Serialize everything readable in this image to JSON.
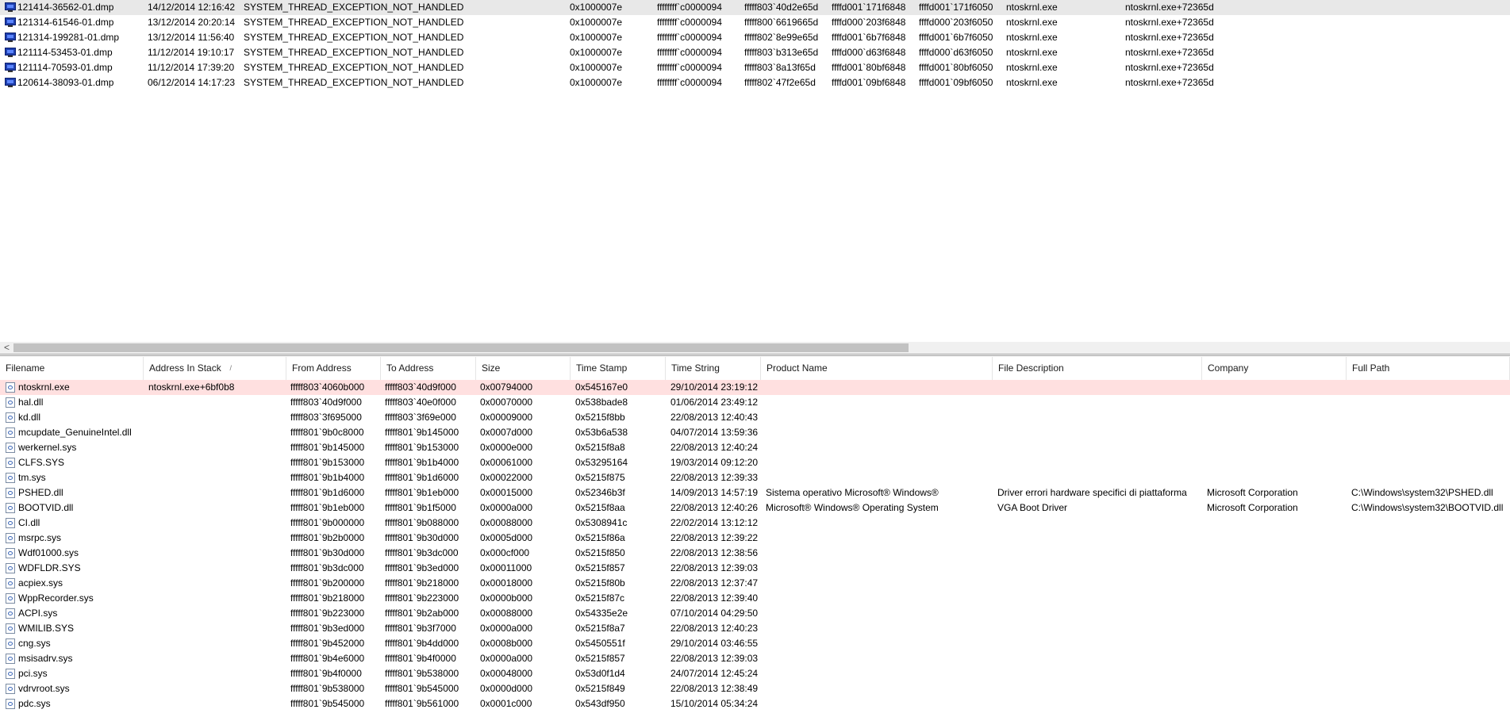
{
  "dump_list": {
    "rows": [
      {
        "file": "121414-36562-01.dmp",
        "date": "14/12/2014 12:16:42",
        "bug": "SYSTEM_THREAD_EXCEPTION_NOT_HANDLED",
        "code": "0x1000007e",
        "p1": "ffffffff`c0000094",
        "p2": "fffff803`40d2e65d",
        "p3": "ffffd001`171f6848",
        "p4": "ffffd001`171f6050",
        "driver": "ntoskrnl.exe",
        "addr": "ntoskrnl.exe+72365d"
      },
      {
        "file": "121314-61546-01.dmp",
        "date": "13/12/2014 20:20:14",
        "bug": "SYSTEM_THREAD_EXCEPTION_NOT_HANDLED",
        "code": "0x1000007e",
        "p1": "ffffffff`c0000094",
        "p2": "fffff800`6619665d",
        "p3": "ffffd000`203f6848",
        "p4": "ffffd000`203f6050",
        "driver": "ntoskrnl.exe",
        "addr": "ntoskrnl.exe+72365d"
      },
      {
        "file": "121314-199281-01.dmp",
        "date": "13/12/2014 11:56:40",
        "bug": "SYSTEM_THREAD_EXCEPTION_NOT_HANDLED",
        "code": "0x1000007e",
        "p1": "ffffffff`c0000094",
        "p2": "fffff802`8e99e65d",
        "p3": "ffffd001`6b7f6848",
        "p4": "ffffd001`6b7f6050",
        "driver": "ntoskrnl.exe",
        "addr": "ntoskrnl.exe+72365d"
      },
      {
        "file": "121114-53453-01.dmp",
        "date": "11/12/2014 19:10:17",
        "bug": "SYSTEM_THREAD_EXCEPTION_NOT_HANDLED",
        "code": "0x1000007e",
        "p1": "ffffffff`c0000094",
        "p2": "fffff803`b313e65d",
        "p3": "ffffd000`d63f6848",
        "p4": "ffffd000`d63f6050",
        "driver": "ntoskrnl.exe",
        "addr": "ntoskrnl.exe+72365d"
      },
      {
        "file": "121114-70593-01.dmp",
        "date": "11/12/2014 17:39:20",
        "bug": "SYSTEM_THREAD_EXCEPTION_NOT_HANDLED",
        "code": "0x1000007e",
        "p1": "ffffffff`c0000094",
        "p2": "fffff803`8a13f65d",
        "p3": "ffffd001`80bf6848",
        "p4": "ffffd001`80bf6050",
        "driver": "ntoskrnl.exe",
        "addr": "ntoskrnl.exe+72365d"
      },
      {
        "file": "120614-38093-01.dmp",
        "date": "06/12/2014 14:17:23",
        "bug": "SYSTEM_THREAD_EXCEPTION_NOT_HANDLED",
        "code": "0x1000007e",
        "p1": "ffffffff`c0000094",
        "p2": "fffff802`47f2e65d",
        "p3": "ffffd001`09bf6848",
        "p4": "ffffd001`09bf6050",
        "driver": "ntoskrnl.exe",
        "addr": "ntoskrnl.exe+72365d"
      }
    ]
  },
  "scrollbar": {
    "left_arrow": "<"
  },
  "module_list": {
    "columns": [
      "Filename",
      "Address In Stack",
      "From Address",
      "To Address",
      "Size",
      "Time Stamp",
      "Time String",
      "Product Name",
      "File Description",
      "Company",
      "Full Path"
    ],
    "sort_indicator": "/",
    "rows": [
      {
        "name": "ntoskrnl.exe",
        "stack": "ntoskrnl.exe+6bf0b8",
        "from": "fffff803`4060b000",
        "to": "fffff803`40d9f000",
        "size": "0x00794000",
        "ts": "0x545167e0",
        "tstr": "29/10/2014 23:19:12",
        "product": "",
        "desc": "",
        "company": "",
        "path": ""
      },
      {
        "name": "hal.dll",
        "stack": "",
        "from": "fffff803`40d9f000",
        "to": "fffff803`40e0f000",
        "size": "0x00070000",
        "ts": "0x538bade8",
        "tstr": "01/06/2014 23:49:12",
        "product": "",
        "desc": "",
        "company": "",
        "path": ""
      },
      {
        "name": "kd.dll",
        "stack": "",
        "from": "fffff803`3f695000",
        "to": "fffff803`3f69e000",
        "size": "0x00009000",
        "ts": "0x5215f8bb",
        "tstr": "22/08/2013 12:40:43",
        "product": "",
        "desc": "",
        "company": "",
        "path": ""
      },
      {
        "name": "mcupdate_GenuineIntel.dll",
        "stack": "",
        "from": "fffff801`9b0c8000",
        "to": "fffff801`9b145000",
        "size": "0x0007d000",
        "ts": "0x53b6a538",
        "tstr": "04/07/2014 13:59:36",
        "product": "",
        "desc": "",
        "company": "",
        "path": ""
      },
      {
        "name": "werkernel.sys",
        "stack": "",
        "from": "fffff801`9b145000",
        "to": "fffff801`9b153000",
        "size": "0x0000e000",
        "ts": "0x5215f8a8",
        "tstr": "22/08/2013 12:40:24",
        "product": "",
        "desc": "",
        "company": "",
        "path": ""
      },
      {
        "name": "CLFS.SYS",
        "stack": "",
        "from": "fffff801`9b153000",
        "to": "fffff801`9b1b4000",
        "size": "0x00061000",
        "ts": "0x53295164",
        "tstr": "19/03/2014 09:12:20",
        "product": "",
        "desc": "",
        "company": "",
        "path": ""
      },
      {
        "name": "tm.sys",
        "stack": "",
        "from": "fffff801`9b1b4000",
        "to": "fffff801`9b1d6000",
        "size": "0x00022000",
        "ts": "0x5215f875",
        "tstr": "22/08/2013 12:39:33",
        "product": "",
        "desc": "",
        "company": "",
        "path": ""
      },
      {
        "name": "PSHED.dll",
        "stack": "",
        "from": "fffff801`9b1d6000",
        "to": "fffff801`9b1eb000",
        "size": "0x00015000",
        "ts": "0x52346b3f",
        "tstr": "14/09/2013 14:57:19",
        "product": "Sistema operativo Microsoft® Windows®",
        "desc": "Driver errori hardware specifici di piattaforma",
        "company": "Microsoft Corporation",
        "path": "C:\\Windows\\system32\\PSHED.dll"
      },
      {
        "name": "BOOTVID.dll",
        "stack": "",
        "from": "fffff801`9b1eb000",
        "to": "fffff801`9b1f5000",
        "size": "0x0000a000",
        "ts": "0x5215f8aa",
        "tstr": "22/08/2013 12:40:26",
        "product": "Microsoft® Windows® Operating System",
        "desc": "VGA Boot Driver",
        "company": "Microsoft Corporation",
        "path": "C:\\Windows\\system32\\BOOTVID.dll"
      },
      {
        "name": "CI.dll",
        "stack": "",
        "from": "fffff801`9b000000",
        "to": "fffff801`9b088000",
        "size": "0x00088000",
        "ts": "0x5308941c",
        "tstr": "22/02/2014 13:12:12",
        "product": "",
        "desc": "",
        "company": "",
        "path": ""
      },
      {
        "name": "msrpc.sys",
        "stack": "",
        "from": "fffff801`9b2b0000",
        "to": "fffff801`9b30d000",
        "size": "0x0005d000",
        "ts": "0x5215f86a",
        "tstr": "22/08/2013 12:39:22",
        "product": "",
        "desc": "",
        "company": "",
        "path": ""
      },
      {
        "name": "Wdf01000.sys",
        "stack": "",
        "from": "fffff801`9b30d000",
        "to": "fffff801`9b3dc000",
        "size": "0x000cf000",
        "ts": "0x5215f850",
        "tstr": "22/08/2013 12:38:56",
        "product": "",
        "desc": "",
        "company": "",
        "path": ""
      },
      {
        "name": "WDFLDR.SYS",
        "stack": "",
        "from": "fffff801`9b3dc000",
        "to": "fffff801`9b3ed000",
        "size": "0x00011000",
        "ts": "0x5215f857",
        "tstr": "22/08/2013 12:39:03",
        "product": "",
        "desc": "",
        "company": "",
        "path": ""
      },
      {
        "name": "acpiex.sys",
        "stack": "",
        "from": "fffff801`9b200000",
        "to": "fffff801`9b218000",
        "size": "0x00018000",
        "ts": "0x5215f80b",
        "tstr": "22/08/2013 12:37:47",
        "product": "",
        "desc": "",
        "company": "",
        "path": ""
      },
      {
        "name": "WppRecorder.sys",
        "stack": "",
        "from": "fffff801`9b218000",
        "to": "fffff801`9b223000",
        "size": "0x0000b000",
        "ts": "0x5215f87c",
        "tstr": "22/08/2013 12:39:40",
        "product": "",
        "desc": "",
        "company": "",
        "path": ""
      },
      {
        "name": "ACPI.sys",
        "stack": "",
        "from": "fffff801`9b223000",
        "to": "fffff801`9b2ab000",
        "size": "0x00088000",
        "ts": "0x54335e2e",
        "tstr": "07/10/2014 04:29:50",
        "product": "",
        "desc": "",
        "company": "",
        "path": ""
      },
      {
        "name": "WMILIB.SYS",
        "stack": "",
        "from": "fffff801`9b3ed000",
        "to": "fffff801`9b3f7000",
        "size": "0x0000a000",
        "ts": "0x5215f8a7",
        "tstr": "22/08/2013 12:40:23",
        "product": "",
        "desc": "",
        "company": "",
        "path": ""
      },
      {
        "name": "cng.sys",
        "stack": "",
        "from": "fffff801`9b452000",
        "to": "fffff801`9b4dd000",
        "size": "0x0008b000",
        "ts": "0x5450551f",
        "tstr": "29/10/2014 03:46:55",
        "product": "",
        "desc": "",
        "company": "",
        "path": ""
      },
      {
        "name": "msisadrv.sys",
        "stack": "",
        "from": "fffff801`9b4e6000",
        "to": "fffff801`9b4f0000",
        "size": "0x0000a000",
        "ts": "0x5215f857",
        "tstr": "22/08/2013 12:39:03",
        "product": "",
        "desc": "",
        "company": "",
        "path": ""
      },
      {
        "name": "pci.sys",
        "stack": "",
        "from": "fffff801`9b4f0000",
        "to": "fffff801`9b538000",
        "size": "0x00048000",
        "ts": "0x53d0f1d4",
        "tstr": "24/07/2014 12:45:24",
        "product": "",
        "desc": "",
        "company": "",
        "path": ""
      },
      {
        "name": "vdrvroot.sys",
        "stack": "",
        "from": "fffff801`9b538000",
        "to": "fffff801`9b545000",
        "size": "0x0000d000",
        "ts": "0x5215f849",
        "tstr": "22/08/2013 12:38:49",
        "product": "",
        "desc": "",
        "company": "",
        "path": ""
      },
      {
        "name": "pdc.sys",
        "stack": "",
        "from": "fffff801`9b545000",
        "to": "fffff801`9b561000",
        "size": "0x0001c000",
        "ts": "0x543df950",
        "tstr": "15/10/2014 05:34:24",
        "product": "",
        "desc": "",
        "company": "",
        "path": ""
      }
    ]
  },
  "icons": {
    "dump_icon": "monitor-icon",
    "file_icon": "dll-file-icon"
  }
}
